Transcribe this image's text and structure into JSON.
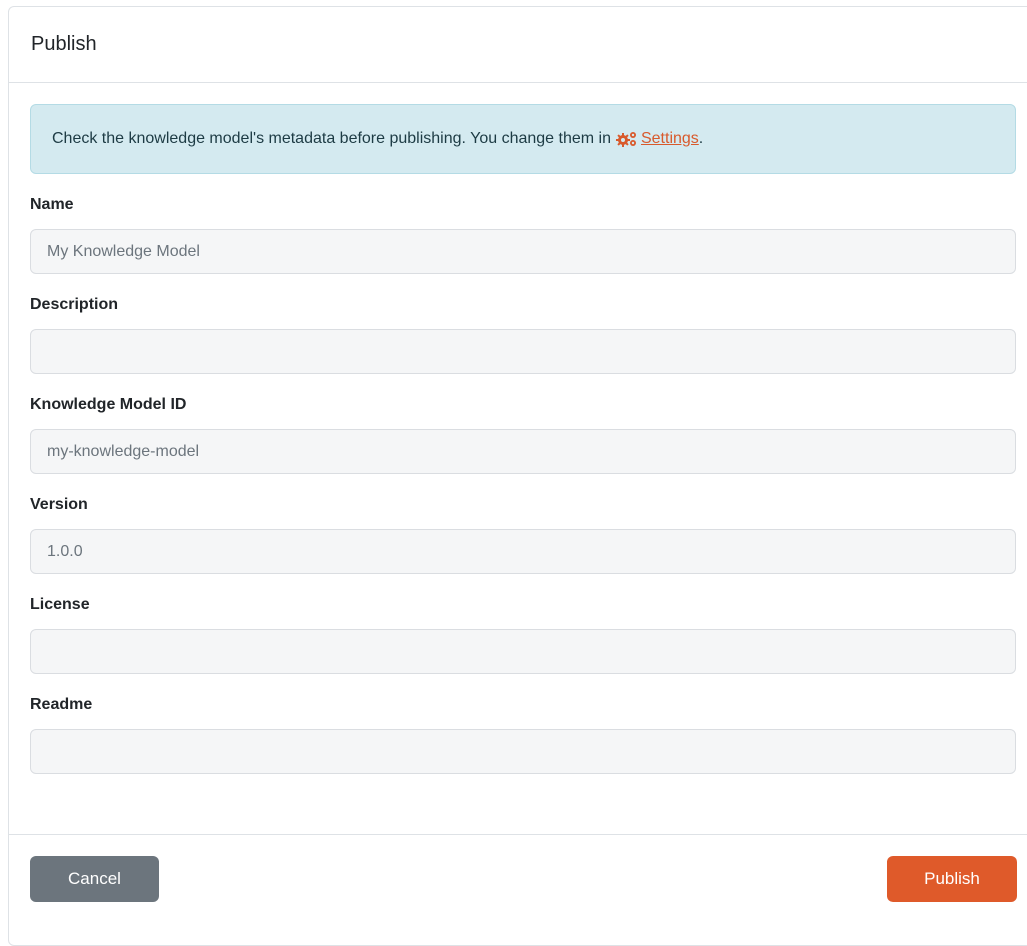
{
  "modal": {
    "title": "Publish"
  },
  "alert": {
    "text": "Check the knowledge model's metadata before publishing. You change them in",
    "icon": "gears-icon",
    "link_label": "Settings",
    "suffix": "."
  },
  "fields": {
    "name": {
      "label": "Name",
      "value": "My Knowledge Model"
    },
    "description": {
      "label": "Description",
      "value": ""
    },
    "km_id": {
      "label": "Knowledge Model ID",
      "value": "my-knowledge-model"
    },
    "version": {
      "label": "Version",
      "value": "1.0.0"
    },
    "license": {
      "label": "License",
      "value": ""
    },
    "readme": {
      "label": "Readme",
      "value": ""
    }
  },
  "footer": {
    "cancel_label": "Cancel",
    "publish_label": "Publish"
  },
  "colors": {
    "primary": "#df5a2a",
    "secondary": "#6c757d",
    "alert_bg": "#d4eaf0"
  }
}
